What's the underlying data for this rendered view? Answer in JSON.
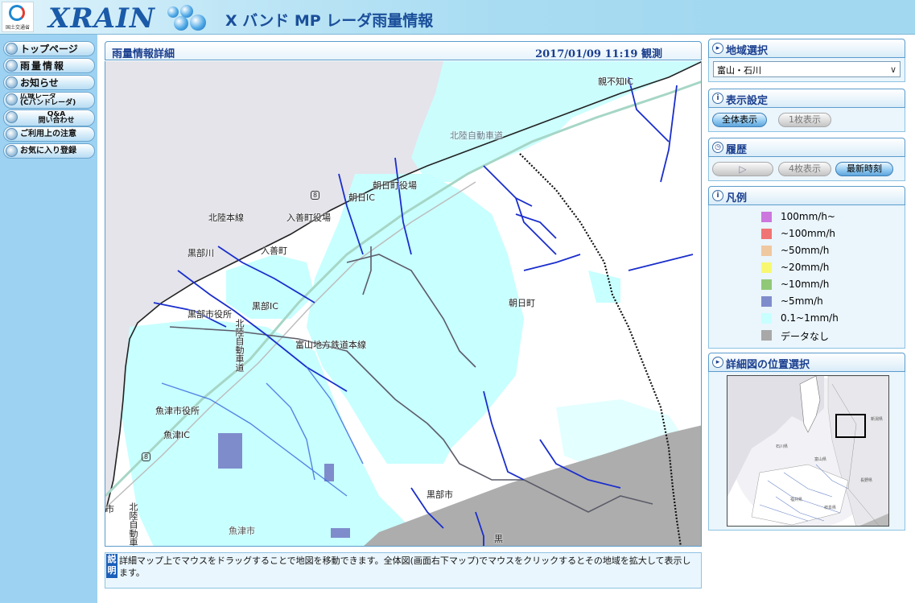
{
  "header": {
    "brand": "XRAIN",
    "title": "X バンド MP レーダ雨量情報",
    "agency": "国土交通省"
  },
  "nav": [
    {
      "label": "トップページ",
      "icon": "home-icon"
    },
    {
      "label": "雨量情報",
      "icon": "rain-icon"
    },
    {
      "label": "お知らせ",
      "icon": "notice-icon"
    },
    {
      "label": "広域レーダ\n(Cバンドレーダ)",
      "icon": "radar-icon"
    },
    {
      "label": "Q&A\n問い合わせ",
      "icon": "question-icon"
    },
    {
      "label": "ご利用上の注意",
      "icon": "caution-icon"
    },
    {
      "label": "お気に入り登録",
      "icon": "bookmark-icon"
    }
  ],
  "main": {
    "title": "雨量情報詳細",
    "timestamp": "2017/01/09 11:19 観測"
  },
  "map_labels": {
    "oyashirazu_ic": "親不知IC",
    "hokuriku_expwy": "北陸自動車道",
    "asahi_town_office": "朝日町役場",
    "asahi_ic": "朝日IC",
    "route8_a": "8",
    "hokuriku_line": "北陸本線",
    "nyuzen_town_office": "入善町役場",
    "nyuzen": "入善町",
    "kurobe_river": "黒部川",
    "asahi": "朝日町",
    "kurobe_ic": "黒部IC",
    "kurobe_city_office": "黒部市役所",
    "hokuriku_expwy_v": "北陸自動車道",
    "toyama_railway": "富山地方鉄道本線",
    "uozu_city_office": "魚津市役所",
    "uozu_ic": "魚津IC",
    "route8_b": "8",
    "kurobe_city": "黒部市",
    "hokuriku_expwy_v2": "北陸自動車",
    "uozu_city": "魚津市",
    "edge_shi": "市",
    "edge_kuro": "黒"
  },
  "description": {
    "tag": "説明",
    "text": "詳細マップ上でマウスをドラッグすることで地図を移動できます。全体図(画面右下マップ)でマウスをクリックするとその地域を拡大して表示します。"
  },
  "region_select": {
    "title": "地域選択",
    "value": "富山・石川"
  },
  "display_settings": {
    "title": "表示設定",
    "all_view": "全体表示",
    "single_view": "1枚表示"
  },
  "history": {
    "title": "履歴",
    "four_view": "4枚表示",
    "latest": "最新時刻"
  },
  "legend": {
    "title": "凡例",
    "items": [
      {
        "label": "100mm/h~",
        "color": "#cc77dd"
      },
      {
        "label": "~100mm/h",
        "color": "#f07474"
      },
      {
        "label": "~50mm/h",
        "color": "#f0c8a0"
      },
      {
        "label": "~20mm/h",
        "color": "#f8f870"
      },
      {
        "label": "~10mm/h",
        "color": "#90c878"
      },
      {
        "label": "~5mm/h",
        "color": "#7f8ccc"
      },
      {
        "label": "0.1~1mm/h",
        "color": "#c8ffff"
      },
      {
        "label": "データなし",
        "color": "#a8a8a8"
      }
    ]
  },
  "overview": {
    "title": "詳細図の位置選択",
    "labels": [
      "新潟県",
      "石川県",
      "富山県",
      "福井県",
      "長野県",
      "岐阜県"
    ]
  }
}
